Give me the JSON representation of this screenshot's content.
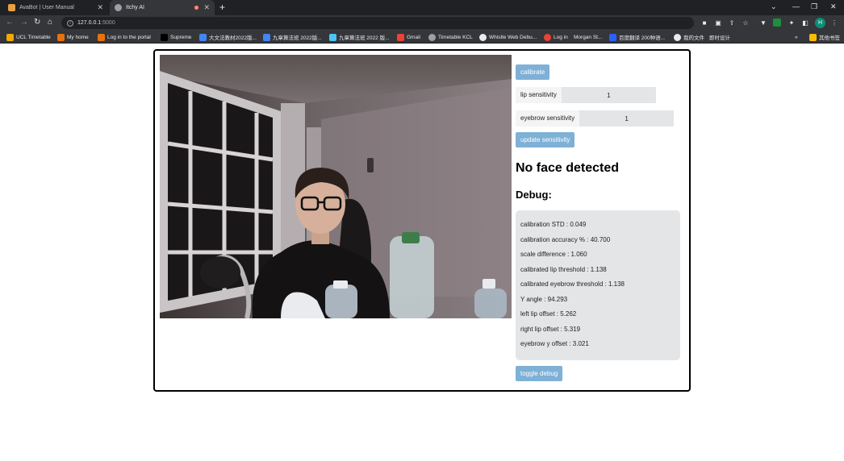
{
  "browser": {
    "tabs": [
      {
        "title": "AvaBot | User Manual",
        "favicon_color": "#e8a045",
        "active": false
      },
      {
        "title": "Itchy AI",
        "favicon_color": "#9aa0a6",
        "active": true
      }
    ],
    "url": {
      "host": "127.0.0.1",
      "port": ":5000"
    },
    "bookmarks": [
      {
        "label": "UCL Timetable",
        "icon_color": "#f2a900"
      },
      {
        "label": "My home",
        "icon_color": "#e8710a"
      },
      {
        "label": "Log in to the portal",
        "icon_color": "#e8710a"
      },
      {
        "label": "Supreme",
        "icon_color": "#000000"
      },
      {
        "label": "大文法教材2022版...",
        "icon_color": "#4285f4"
      },
      {
        "label": "九章算法班 2022版...",
        "icon_color": "#4285f4"
      },
      {
        "label": "九章算法班 2022 版...",
        "icon_color": "#4fc3f7"
      },
      {
        "label": "Gmail",
        "icon_color": "#ea4335"
      },
      {
        "label": "Timetable KCL",
        "icon_color": "#9aa0a6"
      },
      {
        "label": "Whistle Web Debu...",
        "icon_color": "#e8eaed"
      },
      {
        "label": "Log in",
        "icon_color": "#ea4335"
      },
      {
        "label": "Morgan St...",
        "icon_color": "#35363a"
      },
      {
        "label": "百度翻译 200种语...",
        "icon_color": "#2962ff"
      },
      {
        "label": "我的文件",
        "icon_color": "#e8eaed"
      },
      {
        "label": "即时设计",
        "icon_color": "#35363a"
      },
      {
        "label": "其他书签",
        "icon_color": "#fbbc04"
      }
    ]
  },
  "app": {
    "calibrate_label": "calibrate",
    "lip_sensitivity": {
      "label": "lip sensitivity",
      "value": "1"
    },
    "eyebrow_sensitivity": {
      "label": "eyebrow sensitivity",
      "value": "1"
    },
    "update_label": "update sensitivity",
    "status": "No face detected",
    "debug_title": "Debug:",
    "debug_lines": [
      "calibration STD : 0.049",
      "calibration accuracy % : 40.700",
      "scale difference : 1.060",
      "calibrated lip threshold : 1.138",
      "calibrated eyebrow threshold : 1.138",
      "Y angle : 94.293",
      "left lip offset : 5.262",
      "right lip offset : 5.319",
      "eyebrow y offset : 3.021"
    ],
    "toggle_label": "toggle debug"
  }
}
